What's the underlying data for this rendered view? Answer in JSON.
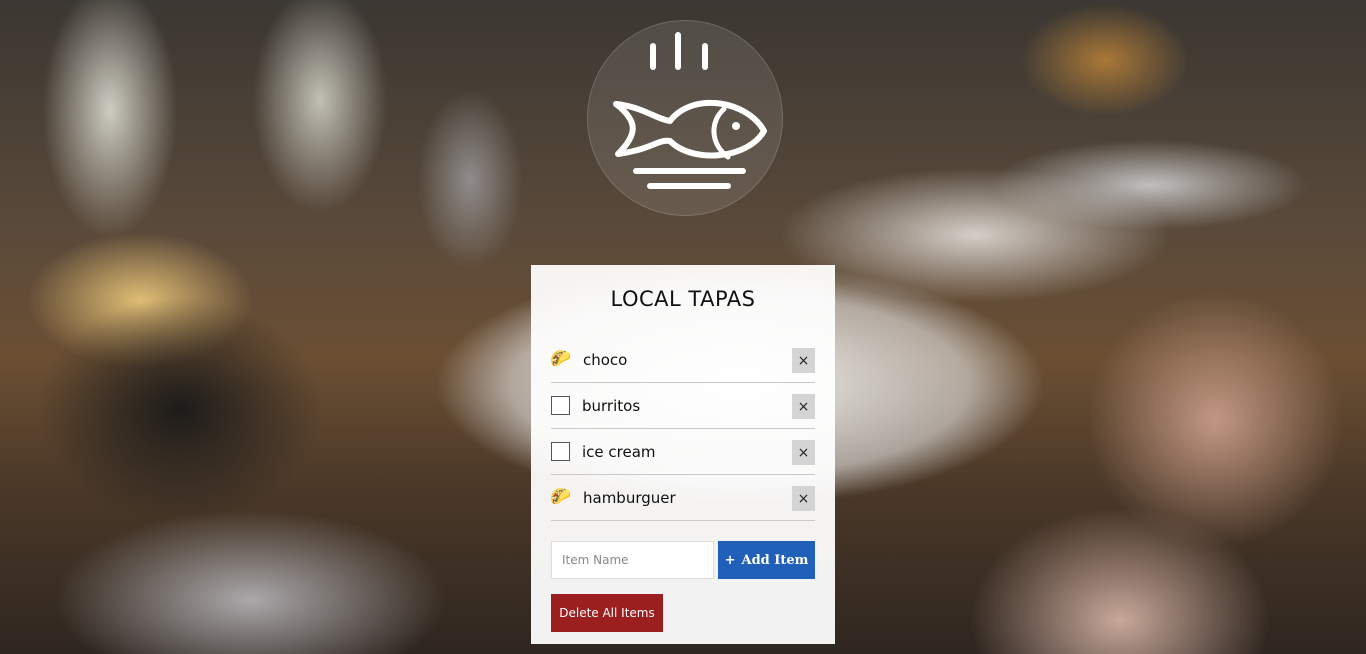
{
  "app": {
    "title": "LOCAL TAPAS",
    "logo_icon": "fish-plate-icon"
  },
  "items": [
    {
      "label": "choco",
      "checked": true,
      "check_icon": "🌮"
    },
    {
      "label": "burritos",
      "checked": false,
      "check_icon": ""
    },
    {
      "label": "ice cream",
      "checked": false,
      "check_icon": ""
    },
    {
      "label": "hamburguer",
      "checked": true,
      "check_icon": "🌮"
    }
  ],
  "delete_item_label": "×",
  "form": {
    "input_value": "",
    "input_placeholder": "Item Name",
    "add_button_icon": "+",
    "add_button_label": "Add Item"
  },
  "delete_all_label": "Delete All Items",
  "colors": {
    "add_button": "#2160b9",
    "delete_all_button": "#9b1f1f"
  }
}
